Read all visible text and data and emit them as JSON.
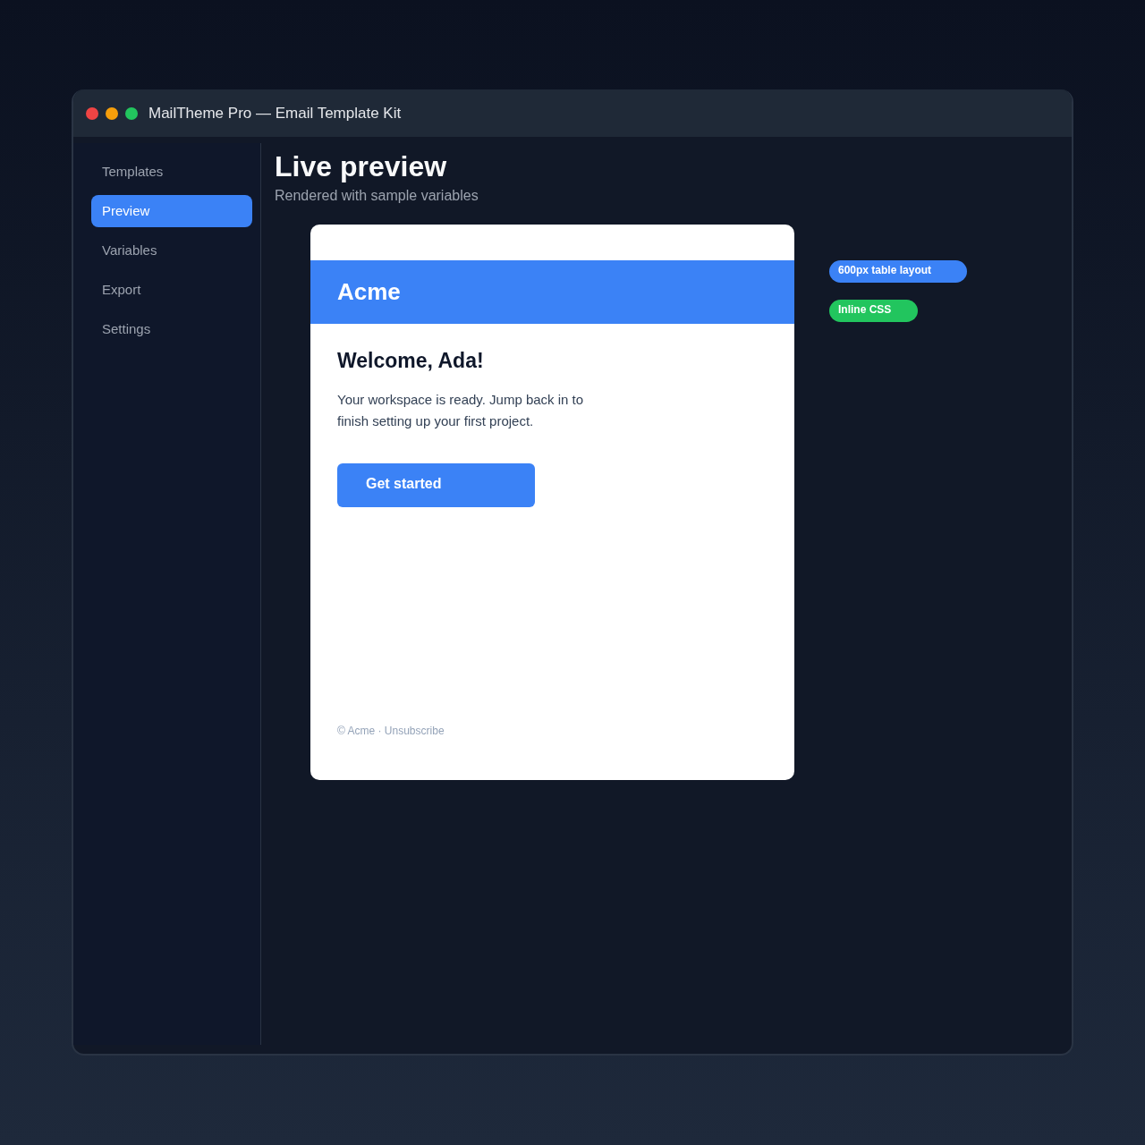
{
  "window": {
    "title": "MailTheme Pro — Email Template Kit"
  },
  "sidebar": {
    "items": [
      {
        "label": "Templates",
        "selected": false
      },
      {
        "label": "Preview",
        "selected": true
      },
      {
        "label": "Variables",
        "selected": false
      },
      {
        "label": "Export",
        "selected": false
      },
      {
        "label": "Settings",
        "selected": false
      }
    ]
  },
  "main": {
    "title": "Live preview",
    "subtitle": "Rendered with sample variables"
  },
  "email": {
    "brand": "Acme",
    "heading": "Welcome, Ada!",
    "body": "Your workspace is ready. Jump back in to finish setting up your first project.",
    "button": "Get started",
    "footer": "© Acme · Unsubscribe"
  },
  "tags": [
    {
      "label": "600px table layout",
      "color": "#3b82f6"
    },
    {
      "label": "Inline CSS",
      "color": "#22c55e"
    }
  ]
}
